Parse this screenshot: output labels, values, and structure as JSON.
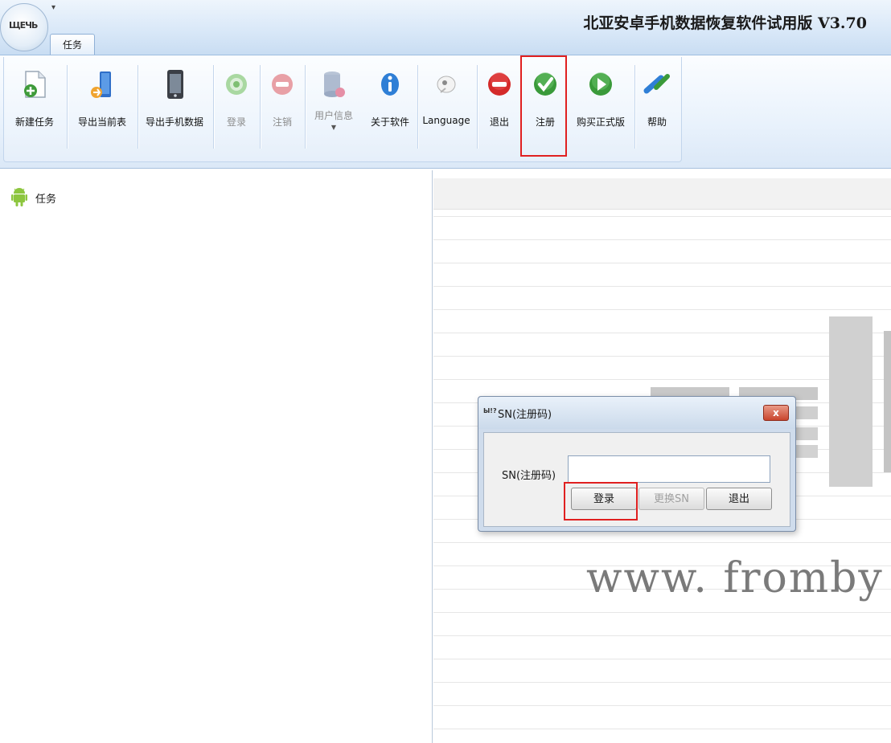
{
  "window": {
    "title": "北亚安卓手机数据恢复软件试用版 V3.70",
    "app_logo_text": "ЩЕЧЬ",
    "qat_arrow": "▾"
  },
  "ribbon": {
    "tab_label": "任务",
    "tools": [
      {
        "label": "新建任务",
        "icon": "new-task-icon",
        "enabled": true
      },
      {
        "label": "导出当前表",
        "icon": "export-table-icon",
        "enabled": true
      },
      {
        "label": "导出手机数据",
        "icon": "export-phone-icon",
        "enabled": true
      },
      {
        "label": "登录",
        "icon": "login-icon",
        "enabled": false
      },
      {
        "label": "注销",
        "icon": "logout-icon",
        "enabled": false
      },
      {
        "label": "用户信息",
        "icon": "user-info-icon",
        "enabled": false
      },
      {
        "label": "关于软件",
        "icon": "about-icon",
        "enabled": true
      },
      {
        "label": "Language",
        "icon": "language-icon",
        "enabled": true
      },
      {
        "label": "退出",
        "icon": "exit-icon",
        "enabled": true
      },
      {
        "label": "注册",
        "icon": "register-icon",
        "enabled": true,
        "highlighted": true
      },
      {
        "label": "购买正式版",
        "icon": "buy-icon",
        "enabled": true
      },
      {
        "label": "帮助",
        "icon": "help-icon",
        "enabled": true
      }
    ]
  },
  "task_tree": {
    "root_label": "任务",
    "root_icon": "android-icon"
  },
  "watermark": {
    "url_text": "www. fromby"
  },
  "dialog": {
    "title": "SN(注册码)",
    "title_icon_text": "Ы!?",
    "close_label": "x",
    "field_label": "SN(注册码)",
    "sn_value": "",
    "buttons": {
      "login": "登录",
      "change_sn": "更换SN",
      "exit": "退出"
    }
  },
  "colors": {
    "highlight": "#e02020",
    "ribbon_bg": "#e9f2fc"
  }
}
